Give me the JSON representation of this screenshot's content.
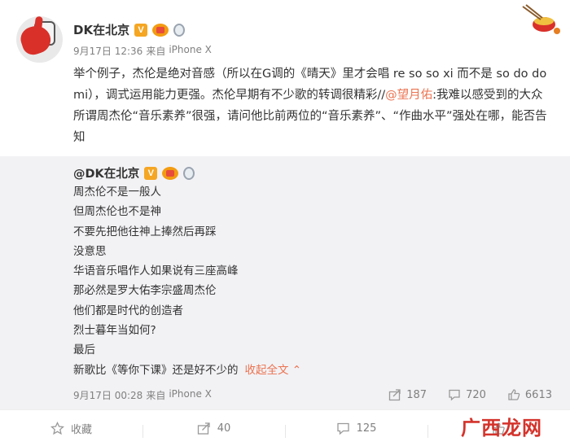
{
  "post": {
    "username": "DK在北京",
    "badge_v": "V",
    "date": "9月17日 12:36",
    "source_prefix": "来自",
    "source": "iPhone X",
    "body_text": "举个例子，杰伦是绝对音感（所以在G调的《晴天》里才会唱 re so so xi 而不是 so do do mi），调式运用能力更强。杰伦早期有不少歌的转调很精彩//",
    "body_mention": "@望月佑",
    "body_text_2": ":我难以感受到的大众所谓周杰伦“音乐素养”很强，请问他比前两位的“音乐素养”、“作曲水平”强处在哪，能否告知"
  },
  "repost": {
    "username": "@DK在北京",
    "badge_v": "V",
    "lines": [
      "周杰伦不是一般人",
      "但周杰伦也不是神",
      "不要先把他往神上捧然后再踩",
      "没意思",
      "华语音乐唱作人如果说有三座高峰",
      "那必然是罗大佑李宗盛周杰伦",
      "他们都是时代的创造者",
      "烈士暮年当如何?",
      "最后",
      "新歌比《等你下课》还是好不少的"
    ],
    "expand_label": "收起全文 ⌃",
    "date": "9月17日 00:28",
    "source_prefix": "来自",
    "source": "iPhone X",
    "stats": {
      "reposts": "187",
      "comments": "720",
      "likes": "6613"
    }
  },
  "toolbar": {
    "favorite_label": "收藏",
    "repost_count": "40",
    "comment_count": "125"
  },
  "watermark": "广西龙网",
  "icons": {
    "favorite": "star-icon",
    "repost": "share-arrow-icon",
    "comment": "comment-bubble-icon",
    "like": "thumbs-up-icon"
  }
}
